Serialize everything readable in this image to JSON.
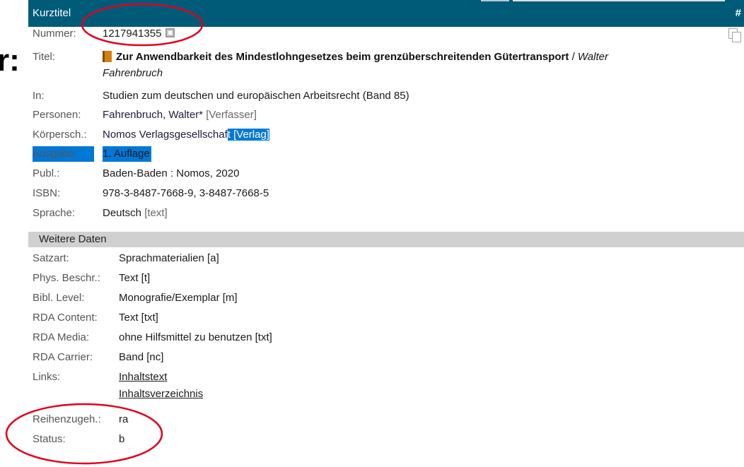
{
  "cut_glyph": "r:",
  "header": {
    "title": "Kurztitel",
    "hash": "#"
  },
  "record": {
    "nummer": {
      "label": "Nummer:",
      "value": "1217941355"
    },
    "titel": {
      "label": "Titel:",
      "title_bold": "Zur Anwendbarkeit des Mindestlohngesetzes beim grenzüberschreitenden Gütertransport",
      "sep": " / ",
      "author_line1": "Walter",
      "author_line2": "Fahrenbruch"
    },
    "in": {
      "label": "In:",
      "value": "Studien zum deutschen und europäischen Arbeitsrecht (Band 85)"
    },
    "personen": {
      "label": "Personen:",
      "value": "Fahrenbruch, Walter*",
      "role": "[Verfasser]"
    },
    "koerpersch": {
      "label": "Körpersch.:",
      "value_plain": "Nomos Verlagsgesellschaf",
      "value_hl": "t [Verlag]"
    },
    "ausgabe": {
      "label": "Ausgabe:",
      "value": "1. Auflage"
    },
    "publ": {
      "label": "Publ.:",
      "value": "Baden-Baden : Nomos, 2020"
    },
    "isbn": {
      "label": "ISBN:",
      "value": "978-3-8487-7668-9, 3-8487-7668-5"
    },
    "sprache": {
      "label": "Sprache:",
      "value": "Deutsch",
      "code": "[text]"
    }
  },
  "weitere": {
    "title": "Weitere Daten",
    "satzart": {
      "label": "Satzart:",
      "value": "Sprachmaterialien [a]"
    },
    "phys": {
      "label": "Phys. Beschr.:",
      "value": "Text [t]"
    },
    "bibl": {
      "label": "Bibl. Level:",
      "value": "Monografie/Exemplar [m]"
    },
    "rda_content": {
      "label": "RDA Content:",
      "value": "Text [txt]"
    },
    "rda_media": {
      "label": "RDA Media:",
      "value": "ohne Hilfsmittel zu benutzen [txt]"
    },
    "rda_carrier": {
      "label": "RDA Carrier:",
      "value": "Band [nc]"
    },
    "links": {
      "label": "Links:",
      "link1": "Inhaltstext",
      "link2": "Inhaltsverzeichnis"
    },
    "reihenzugeh": {
      "label": "Reihenzugeh.:",
      "value": "ra"
    },
    "status": {
      "label": "Status:",
      "value": "b"
    }
  },
  "colors": {
    "header_bg": "#005b79",
    "section_bg": "#d0d0d0",
    "highlight": "#0078d7",
    "annotation": "#e0001b",
    "link": "#0a55c4"
  },
  "icons": [
    "book-icon",
    "copy-icon",
    "small-square-icon"
  ]
}
